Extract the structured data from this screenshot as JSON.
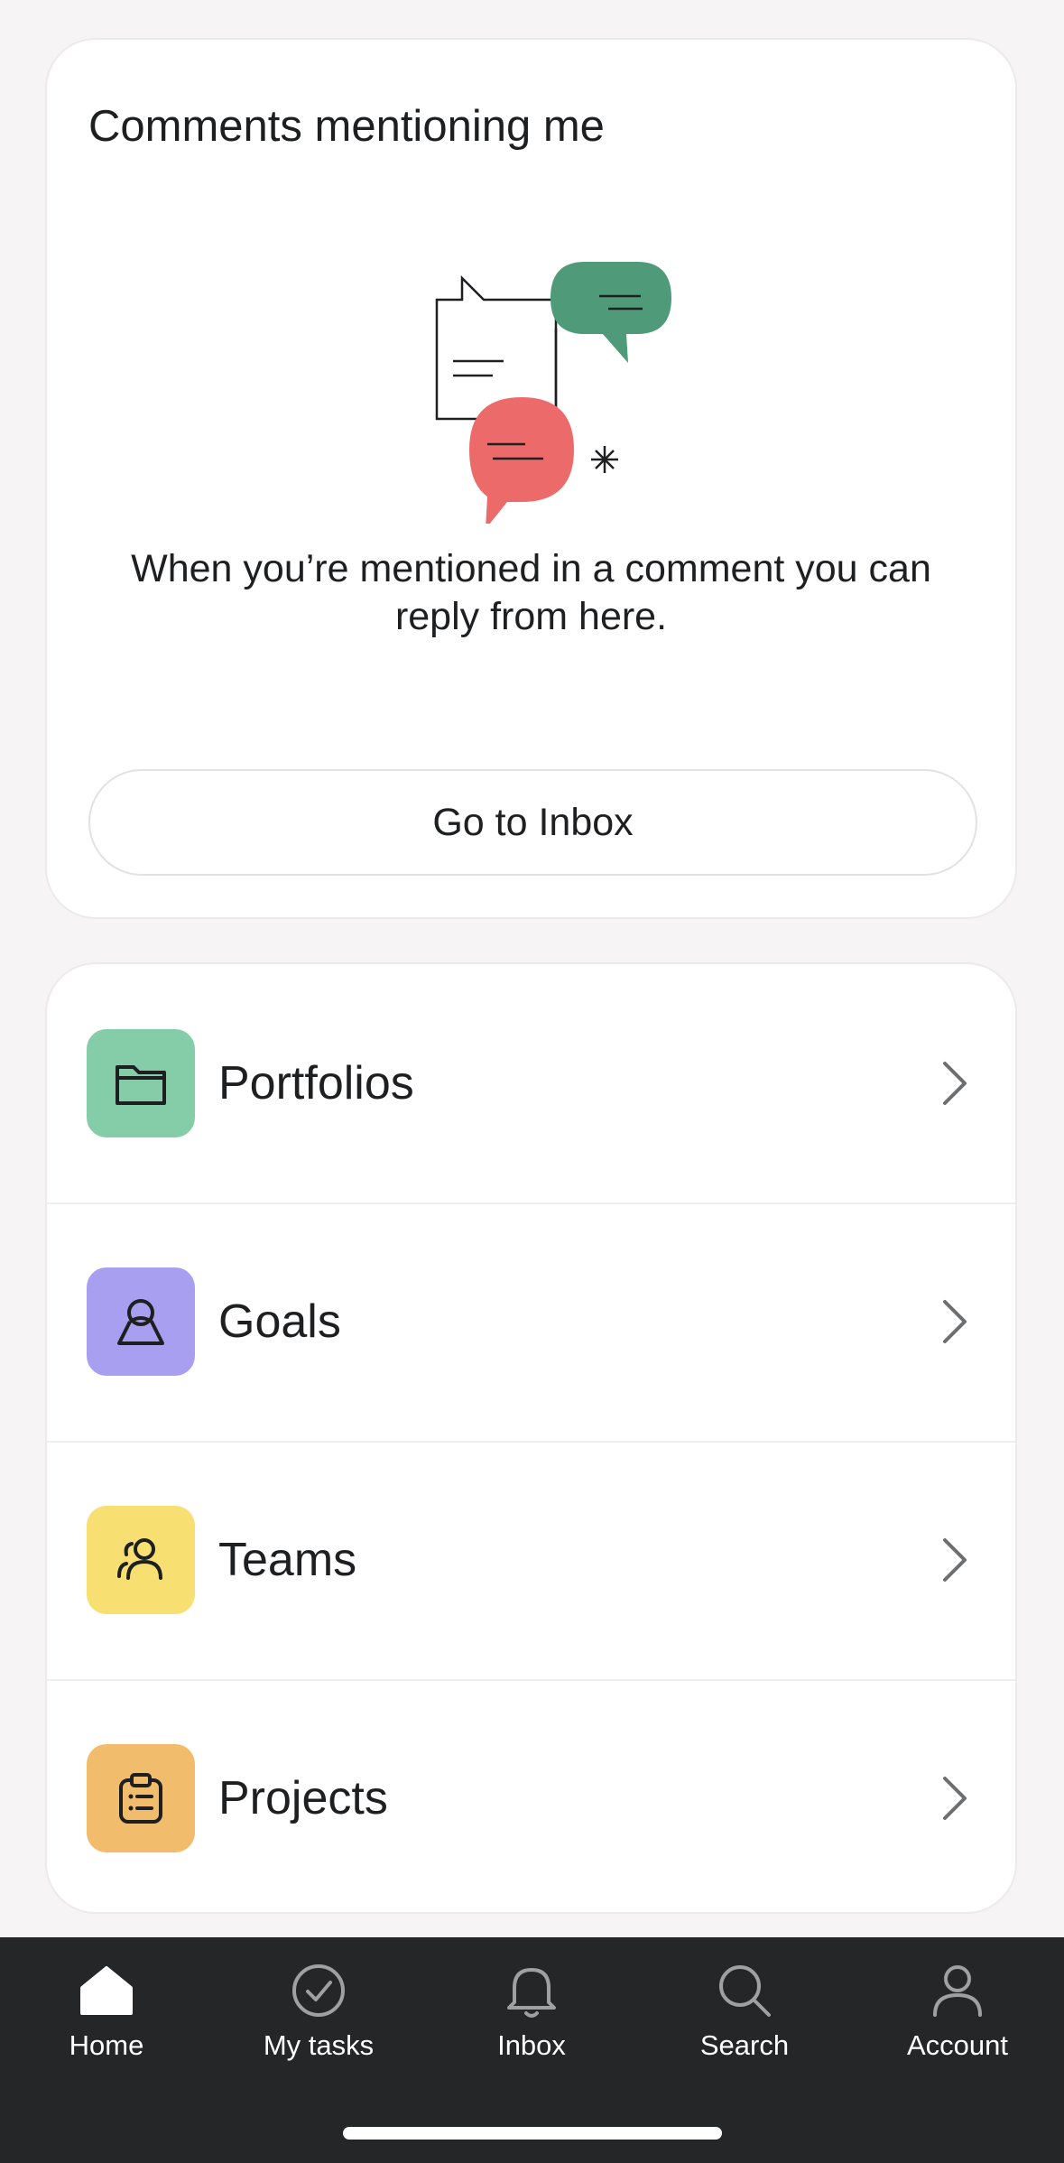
{
  "comments_card": {
    "title": "Comments mentioning me",
    "message": "When you’re mentioned in a comment you can reply from here.",
    "button_label": "Go to Inbox"
  },
  "links": [
    {
      "label": "Portfolios",
      "icon": "folder-icon",
      "color": "#85cca8"
    },
    {
      "label": "Goals",
      "icon": "goal-icon",
      "color": "#a89ff0"
    },
    {
      "label": "Teams",
      "icon": "people-icon",
      "color": "#f8df72"
    },
    {
      "label": "Projects",
      "icon": "clipboard-list-icon",
      "color": "#f1bd6c"
    }
  ],
  "tabbar": {
    "items": [
      {
        "label": "Home",
        "icon": "home-icon",
        "active": true
      },
      {
        "label": "My tasks",
        "icon": "check-circle-icon",
        "active": false
      },
      {
        "label": "Inbox",
        "icon": "bell-icon",
        "active": false
      },
      {
        "label": "Search",
        "icon": "search-icon",
        "active": false
      },
      {
        "label": "Account",
        "icon": "person-icon",
        "active": false
      }
    ]
  },
  "colors": {
    "background": "#f6f4f4",
    "tabbar": "#252628",
    "speech_green": "#4f9a78",
    "speech_red": "#ec6a6a"
  }
}
